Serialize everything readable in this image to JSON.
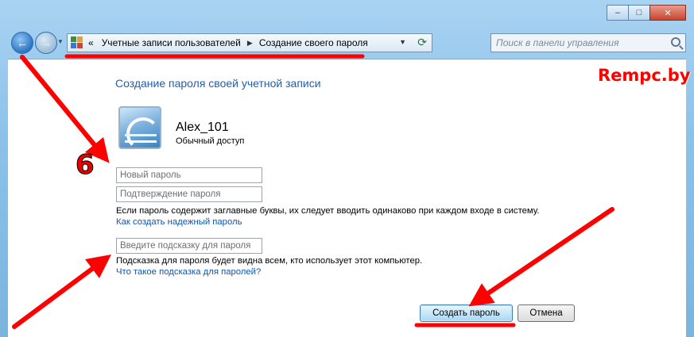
{
  "window": {
    "caption_buttons": {
      "minimize": "–",
      "maximize": "□",
      "close": "✕"
    }
  },
  "navbar": {
    "back_icon": "arrow-left-icon",
    "forward_icon": "arrow-right-icon",
    "breadcrumbs": [
      {
        "label": "Учетные записи пользователей"
      },
      {
        "label": "Создание своего пароля"
      }
    ],
    "breadcrumb_prefix": "«",
    "search_placeholder": "Поиск в панели управления"
  },
  "watermark": "Rempc.by",
  "main": {
    "title": "Создание пароля своей учетной записи",
    "user": {
      "name": "Alex_101",
      "role": "Обычный доступ"
    },
    "new_password_placeholder": "Новый пароль",
    "confirm_password_placeholder": "Подтверждение пароля",
    "case_note": "Если пароль содержит заглавные буквы, их следует вводить одинаково при каждом входе в систему.",
    "strong_password_link": "Как создать надежный пароль",
    "hint_placeholder": "Введите подсказку для пароля",
    "hint_note": "Подсказка для пароля будет видна всем, кто использует этот компьютер.",
    "hint_link": "Что такое подсказка для паролей?",
    "create_button": "Создать пароль",
    "cancel_button": "Отмена"
  },
  "annotations": {
    "step_number": "6",
    "color": "#ff0000"
  }
}
